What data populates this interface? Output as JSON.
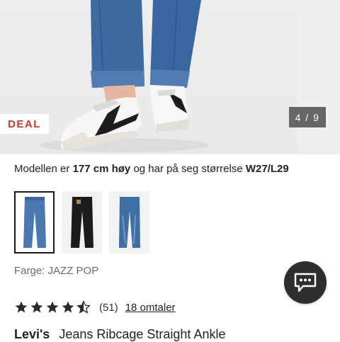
{
  "gallery": {
    "badge": "DEAL",
    "counter": "4 / 9"
  },
  "model_info": {
    "prefix": "Modellen er",
    "height": "177 cm høy",
    "middle": "og har på seg størrelse",
    "size": "W27/L29"
  },
  "thumbnails": [
    {
      "label": "jeans-jazz-pop",
      "selected": true
    },
    {
      "label": "jeans-black",
      "selected": false
    },
    {
      "label": "jeans-mid-blue",
      "selected": false
    }
  ],
  "color_label": "Farge: JAZZ POP",
  "rating": {
    "stars": 4.5,
    "count": "(51)",
    "reviews_link": "18 omtaler"
  },
  "product": {
    "brand": "Levi's",
    "name": "Jeans Ribcage Straight Ankle"
  },
  "colors": {
    "deal_red": "#c0392b",
    "counter_bg": "#666666",
    "chat_bg": "#2e2e2e",
    "denim": "#3f6ea5"
  },
  "icons": {
    "chat": "chat-bubble-icon",
    "star": "star-icon"
  }
}
